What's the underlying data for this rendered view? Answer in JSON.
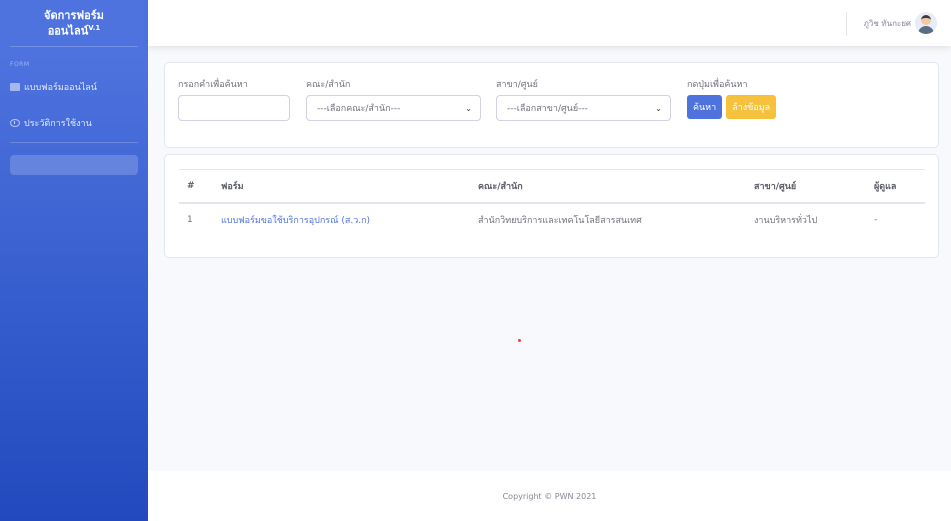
{
  "sidebar": {
    "brand_line1": "จัดการฟอร์ม",
    "brand_line2": "ออนไลน์",
    "brand_version": "V.1",
    "heading": "FORM",
    "items": [
      {
        "label": "แบบฟอร์มออนไลน์",
        "icon": "form-icon"
      },
      {
        "label": "ประวัติการใช้งาน",
        "icon": "history-icon"
      }
    ]
  },
  "topbar": {
    "user_name": "ภูวิช ทันกะยศ"
  },
  "search": {
    "keyword_label": "กรอกคำเพื่อค้นหา",
    "keyword_value": "",
    "faculty_label": "คณะ/สำนัก",
    "faculty_selected": "---เลือกคณะ/สำนัก---",
    "branch_label": "สาขา/ศูนย์",
    "branch_selected": "---เลือกสาขา/ศูนย์---",
    "action_label": "กดปุ่มเพื่อค้นหา",
    "search_button": "ค้นหา",
    "clear_button": "ล้างข้อมูล"
  },
  "table": {
    "headers": [
      "#",
      "ฟอร์ม",
      "คณะ/สำนัก",
      "สาขา/ศูนย์",
      "ผู้ดูแล"
    ],
    "rows": [
      {
        "no": "1",
        "form": "แบบฟอร์มขอใช้บริการอุปกรณ์ (ส.ว.ก)",
        "faculty": "สำนักวิทยบริการและเทคโนโลยีสารสนเทศ",
        "branch": "งานบริหารทั่วไป",
        "admin": "-"
      }
    ]
  },
  "footer": {
    "copyright": "Copyright © PWN 2021"
  },
  "colors": {
    "primary": "#4e73df",
    "warning": "#f6c23e",
    "sidebar_gradient_end": "#224abe"
  }
}
